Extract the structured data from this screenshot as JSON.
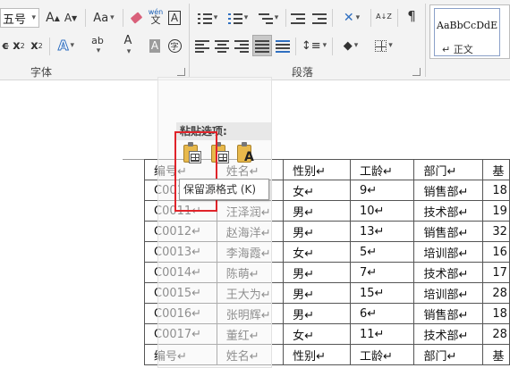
{
  "ribbon": {
    "font": {
      "size_value": "五号",
      "grow_label": "A",
      "shrink_label": "A",
      "case_label": "Aa",
      "pinyin_label": "wén",
      "border_char_label": "A",
      "subscript_label": "x",
      "superscript_label": "x",
      "text_effect_label": "A",
      "highlight_label": "ab",
      "font_color_label": "A",
      "char_shading_label": "A",
      "enclose_char_label": "字",
      "group_label": "字体",
      "colors": {
        "highlight": "#ffff00",
        "font_color": "#c00000"
      }
    },
    "paragraph": {
      "group_label": "段落",
      "sort_label": "A↓Z"
    },
    "styles": {
      "preview_text": "AaBbCcDdE",
      "normal_label": "正文"
    }
  },
  "paste_options": {
    "header": "粘贴选项:",
    "tooltip": "保留源格式 (K)",
    "highlight_color": "#e0232a"
  },
  "table": {
    "rows": [
      [
        "编号↵",
        "姓名↵",
        "性别↵",
        "工龄↵",
        "部门↵",
        "基"
      ],
      [
        "C0010↵",
        "",
        "女↵",
        "9↵",
        "销售部↵",
        "18"
      ],
      [
        "C0011↵",
        "汪泽润↵",
        "男↵",
        "10↵",
        "技术部↵",
        "19"
      ],
      [
        "C0012↵",
        "赵海洋↵",
        "男↵",
        "13↵",
        "销售部↵",
        "32"
      ],
      [
        "C0013↵",
        "李海霞↵",
        "女↵",
        "5↵",
        "培训部↵",
        "16"
      ],
      [
        "C0014↵",
        "陈萌↵",
        "男↵",
        "7↵",
        "技术部↵",
        "17"
      ],
      [
        "C0015↵",
        "王大为↵",
        "男↵",
        "15↵",
        "培训部↵",
        "28"
      ],
      [
        "C0016↵",
        "张明辉↵",
        "男↵",
        "6↵",
        "销售部↵",
        "18"
      ],
      [
        "C0017↵",
        "董红↵",
        "女↵",
        "11↵",
        "技术部↵",
        "28"
      ],
      [
        "编号↵",
        "姓名↵",
        "性别↵",
        "工龄↵",
        "部门↵",
        "基"
      ]
    ]
  }
}
